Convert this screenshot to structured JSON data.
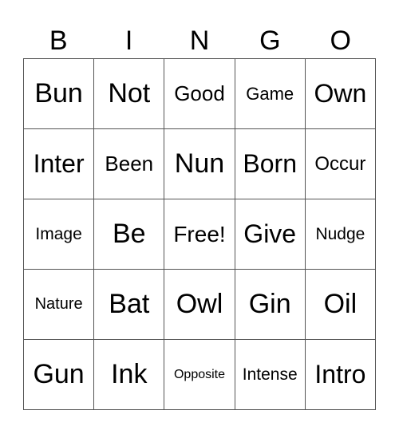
{
  "header": {
    "letters": [
      "B",
      "I",
      "N",
      "G",
      "O"
    ]
  },
  "grid": {
    "rows": [
      [
        "Bun",
        "Not",
        "Good",
        "Game",
        "Own"
      ],
      [
        "Inter",
        "Been",
        "Nun",
        "Born",
        "Occur"
      ],
      [
        "Image",
        "Be",
        "Free!",
        "Give",
        "Nudge"
      ],
      [
        "Nature",
        "Bat",
        "Owl",
        "Gin",
        "Oil"
      ],
      [
        "Gun",
        "Ink",
        "Opposite",
        "Intense",
        "Intro"
      ]
    ],
    "free_space": "Free!"
  }
}
